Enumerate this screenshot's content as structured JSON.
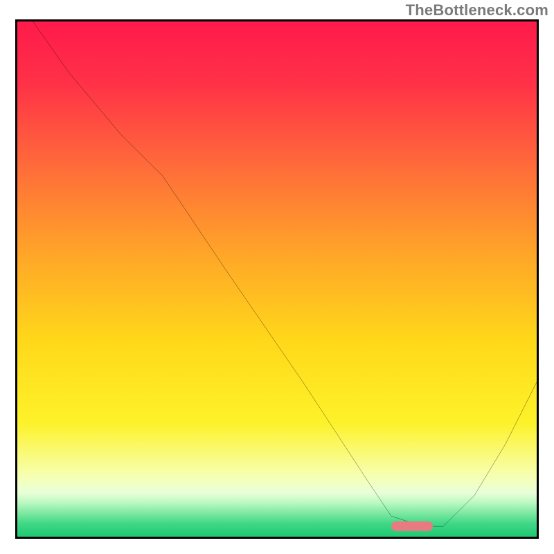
{
  "watermark": "TheBottleneck.com",
  "chart_data": {
    "type": "line",
    "title": "",
    "xlabel": "",
    "ylabel": "",
    "xlim": [
      0,
      100
    ],
    "ylim": [
      0,
      100
    ],
    "grid": false,
    "legend": false,
    "series": [
      {
        "name": "bottleneck-curve",
        "color": "#000000",
        "x": [
          3,
          10,
          20,
          28,
          40,
          55,
          68,
          72,
          78,
          82,
          88,
          94,
          100
        ],
        "y": [
          100,
          90,
          78,
          70,
          52,
          30,
          10,
          4,
          2,
          2,
          8,
          18,
          30
        ]
      }
    ],
    "marker": {
      "name": "optimal-range",
      "color": "#e77b81",
      "x_start": 72,
      "x_end": 80,
      "y": 2
    },
    "background_gradient_stops": [
      {
        "offset": 0.0,
        "color": "#ff1a4b"
      },
      {
        "offset": 0.12,
        "color": "#ff3147"
      },
      {
        "offset": 0.28,
        "color": "#ff6b3a"
      },
      {
        "offset": 0.45,
        "color": "#ffa528"
      },
      {
        "offset": 0.62,
        "color": "#ffd81a"
      },
      {
        "offset": 0.78,
        "color": "#fdf22a"
      },
      {
        "offset": 0.88,
        "color": "#f7ffb0"
      },
      {
        "offset": 0.915,
        "color": "#e8ffd8"
      },
      {
        "offset": 0.935,
        "color": "#b8f8c0"
      },
      {
        "offset": 0.955,
        "color": "#7be8a0"
      },
      {
        "offset": 0.975,
        "color": "#3fd786"
      },
      {
        "offset": 1.0,
        "color": "#1fc971"
      }
    ]
  }
}
